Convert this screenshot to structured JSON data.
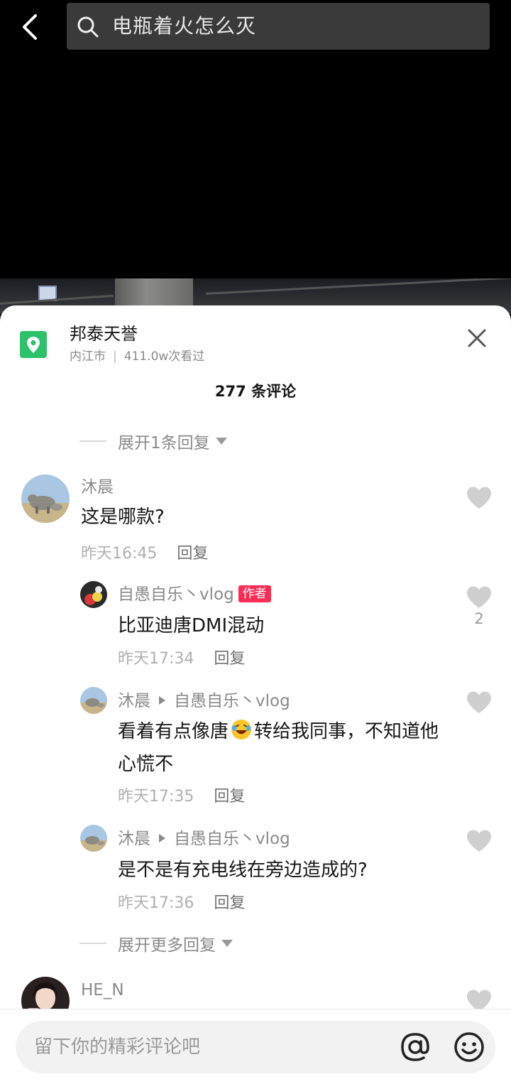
{
  "search": {
    "query": "电瓶着火怎么灭"
  },
  "location": {
    "name": "邦泰天誉",
    "city": "内江市",
    "views": "411.0w次看过"
  },
  "comments_header": {
    "count_label": "277 条评论"
  },
  "expand_top": {
    "label": "展开1条回复"
  },
  "comment_main": {
    "user": "沐晨",
    "text": "这是哪款?",
    "time": "昨天16:45",
    "reply_label": "回复"
  },
  "replies": [
    {
      "user": "自愚自乐丶vlog",
      "badge": "作者",
      "text": "比亚迪唐DMI混动",
      "time": "昨天17:34",
      "reply_label": "回复",
      "likes": "2"
    },
    {
      "user": "沐晨",
      "target": "自愚自乐丶vlog",
      "text_before": "看着有点像唐",
      "text_after": "转给我同事，不知道他心慌不",
      "time": "昨天17:35",
      "reply_label": "回复"
    },
    {
      "user": "沐晨",
      "target": "自愚自乐丶vlog",
      "text": "是不是有充电线在旁边造成的?",
      "time": "昨天17:36",
      "reply_label": "回复"
    }
  ],
  "expand_more": {
    "label": "展开更多回复"
  },
  "comment_next": {
    "user": "HE_N"
  },
  "input": {
    "placeholder": "留下你的精彩评论吧"
  },
  "colors": {
    "accent_badge": "#fe2c55",
    "location_green": "#2bc26a",
    "search_bg": "#3a3a3a"
  },
  "icons": [
    "back-arrow-icon",
    "search-icon",
    "location-pin-icon",
    "close-icon",
    "heart-icon",
    "at-icon",
    "emoji-icon",
    "laughing-emoji-icon",
    "play-arrow-icon"
  ]
}
